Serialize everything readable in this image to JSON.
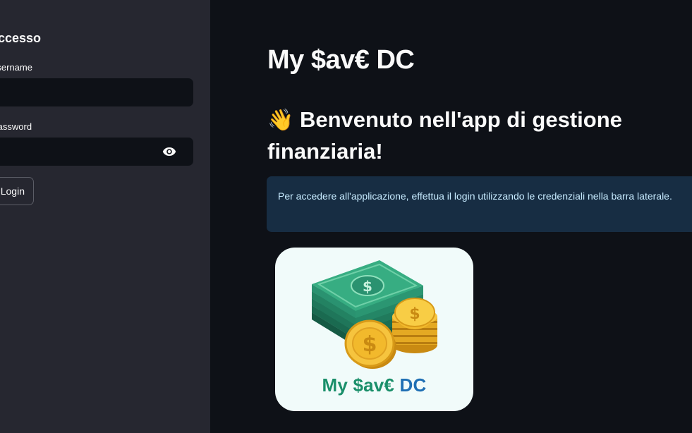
{
  "sidebar": {
    "title": "Accesso",
    "username_label": "Username",
    "username_value": "",
    "password_label": "Password",
    "password_value": "",
    "login_label": "Login",
    "eye_icon": "eye-icon"
  },
  "main": {
    "title": "My $av€ DC",
    "welcome_icon": "👋",
    "welcome_text": "Benvenuto nell'app di gestione finanziaria!",
    "info_text": "Per accedere all'applicazione, effettua il login utilizzando le credenziali nella barra laterale.",
    "logo": {
      "part1": "My $av€",
      "part2": "DC"
    }
  },
  "colors": {
    "background": "#0e1117",
    "sidebar": "#262730",
    "info_bg": "#172d43",
    "info_text": "#c7ebff",
    "logo_green": "#1a8f6a",
    "logo_blue": "#1f6fb4"
  }
}
